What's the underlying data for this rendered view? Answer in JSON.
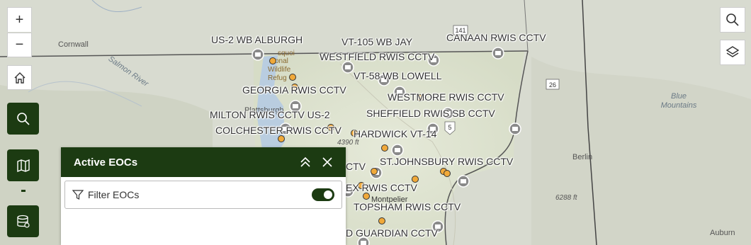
{
  "map": {
    "camera_labels": [
      "US-2 WB ALBURGH",
      "VT-105 WB JAY",
      "CANAAN RWIS CCTV",
      "WESTFIELD RWIS CCTV",
      "VT-58 WB LOWELL",
      "GEORGIA RWIS CCTV",
      "WESTMORE RWIS CCTV",
      "SHEFFIELD RWIS SB CCTV",
      "MILTON RWIS CCTV US-2",
      "COLCHESTER RWIS CCTV",
      "HARDWICK VT-14",
      "CTV",
      "ST.JOHNSBURY RWIS CCTV",
      "EX RWIS CCTV",
      "TOPSHAM RWIS CCTV",
      "D GUARDIAN CCTV"
    ],
    "places": [
      "Cornwall",
      "Salmon River",
      "Blue Mountains",
      "Berlin",
      "Auburn",
      "Plattsburgh",
      "Montpelier",
      "squoi",
      "onal",
      "Wildlife",
      "Refug"
    ],
    "elevations": [
      "4390 ft",
      "6288 ft"
    ],
    "shields": [
      "141",
      "26",
      "5"
    ]
  },
  "controls": {
    "zoom_in": "+",
    "zoom_out": "−"
  },
  "panel": {
    "title": "Active EOCs",
    "filter_label": "Filter EOCs",
    "filter_enabled": true
  },
  "colors": {
    "brand_green": "#1c3b12",
    "marker_orange": "#f0a93a"
  }
}
